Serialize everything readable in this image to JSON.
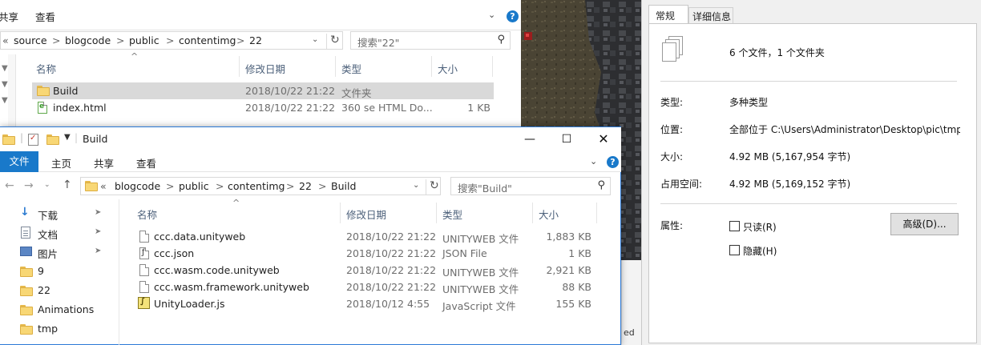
{
  "bg_window": {
    "ribbon_tabs": [
      "共享",
      "查看"
    ],
    "help_icon": "?",
    "address_crumbs": [
      "«",
      "source",
      ">",
      "blogcode",
      ">",
      "public",
      ">",
      "contentimg",
      ">",
      "22"
    ],
    "search_placeholder": "搜索\"22\"",
    "columns": [
      "名称",
      "修改日期",
      "类型",
      "大小"
    ],
    "rows": [
      {
        "name": "Build",
        "date": "2018/10/22 21:22",
        "type": "文件夹",
        "size": ""
      },
      {
        "name": "index.html",
        "date": "2018/10/22 21:22",
        "type": "360 se HTML Do...",
        "size": "1 KB"
      }
    ]
  },
  "front_window": {
    "title": "Build",
    "ribbon_tabs": [
      "文件",
      "主页",
      "共享",
      "查看"
    ],
    "address_crumbs": [
      "«",
      "blogcode",
      ">",
      "public",
      ">",
      "contentimg",
      ">",
      "22",
      ">",
      "Build"
    ],
    "search_placeholder": "搜索\"Build\"",
    "columns": [
      "名称",
      "修改日期",
      "类型",
      "大小"
    ],
    "nav_items": [
      "下载",
      "文档",
      "图片",
      "9",
      "22",
      "Animations",
      "tmp"
    ],
    "files": [
      {
        "name": "ccc.data.unityweb",
        "date": "2018/10/22 21:22",
        "type": "UNITYWEB 文件",
        "size": "1,883 KB"
      },
      {
        "name": "ccc.json",
        "date": "2018/10/22 21:22",
        "type": "JSON File",
        "size": "1 KB"
      },
      {
        "name": "ccc.wasm.code.unityweb",
        "date": "2018/10/22 21:22",
        "type": "UNITYWEB 文件",
        "size": "2,921 KB"
      },
      {
        "name": "ccc.wasm.framework.unityweb",
        "date": "2018/10/22 21:22",
        "type": "UNITYWEB 文件",
        "size": "88 KB"
      },
      {
        "name": "UnityLoader.js",
        "date": "2018/10/12 4:55",
        "type": "JavaScript 文件",
        "size": "155 KB"
      }
    ]
  },
  "properties": {
    "tabs": [
      "常规",
      "详细信息"
    ],
    "summary": "6 个文件，1 个文件夹",
    "type_label": "类型:",
    "type_value": "多种类型",
    "location_label": "位置:",
    "location_value": "全部位于 C:\\Users\\Administrator\\Desktop\\pic\\tmp",
    "size_label": "大小:",
    "size_value": "4.92 MB (5,167,954 字节)",
    "disk_label": "占用空间:",
    "disk_value": "4.92 MB (5,169,152 字节)",
    "attr_label": "属性:",
    "readonly_label": "只读(R)",
    "hidden_label": "隐藏(H)",
    "advanced_button": "高级(D)..."
  },
  "bottom_fragment": "ed",
  "colors": {
    "accent": "#1979ca",
    "border_blue": "#2b79d6",
    "folder": "#f8d775",
    "selected_row": "#d9d9d9"
  }
}
